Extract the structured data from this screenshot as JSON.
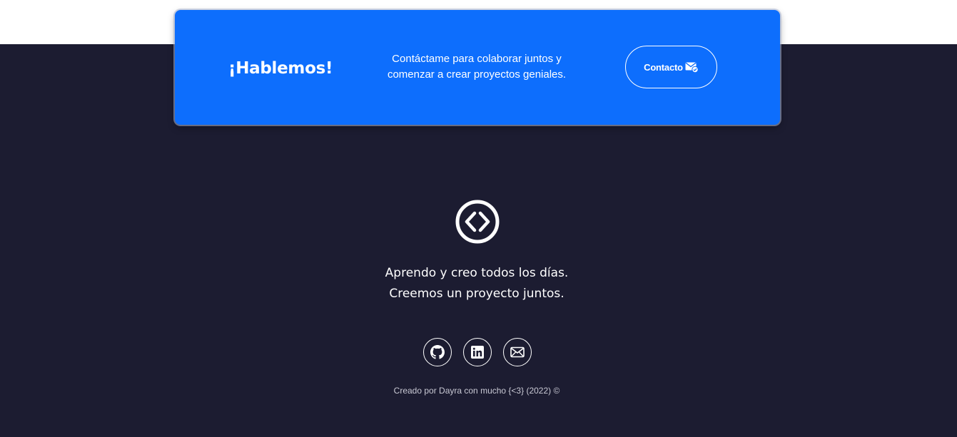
{
  "cta": {
    "title": "¡Hablemos!",
    "line1": "Contáctame para colaborar juntos y",
    "line2": "comenzar a crear proyectos geniales.",
    "button_label": "Contacto",
    "button_icon": "envelope-check-icon"
  },
  "footer": {
    "logo_icon": "code-brackets-circle-icon",
    "tagline_line1": "Aprendo y creo todos los días.",
    "tagline_line2": "Creemos un proyecto juntos.",
    "socials": [
      {
        "name": "github-icon"
      },
      {
        "name": "linkedin-icon"
      },
      {
        "name": "email-icon"
      }
    ],
    "credits": "Creado por Dayra con mucho {<3} (2022) ©"
  },
  "colors": {
    "cta_background": "#0d6efd",
    "footer_background": "#1c1c31",
    "text": "#ffffff",
    "muted_text": "#c9c9d4"
  }
}
